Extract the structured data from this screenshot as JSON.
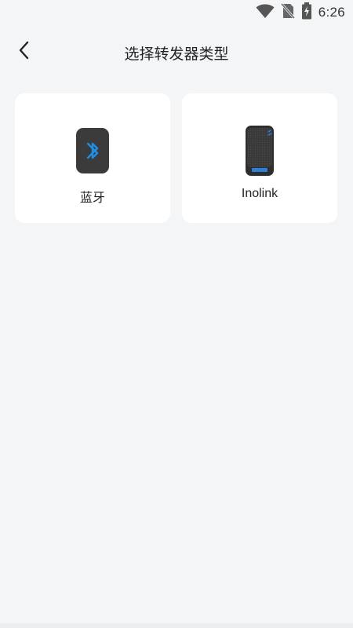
{
  "status_bar": {
    "time": "6:26",
    "icons": [
      "wifi-icon",
      "no-sim-icon",
      "battery-charging-icon"
    ]
  },
  "header": {
    "title": "选择转发器类型",
    "back_icon": "chevron-left-icon"
  },
  "options": [
    {
      "label": "蓝牙",
      "icon": "bluetooth-device-icon",
      "accent": "#1e8fe6"
    },
    {
      "label": "Inolink",
      "icon": "inolink-device-icon",
      "accent": "#2f7fd6"
    }
  ],
  "colors": {
    "background": "#f4f5f7",
    "card": "#ffffff",
    "device_body": "#3a3a3a"
  }
}
